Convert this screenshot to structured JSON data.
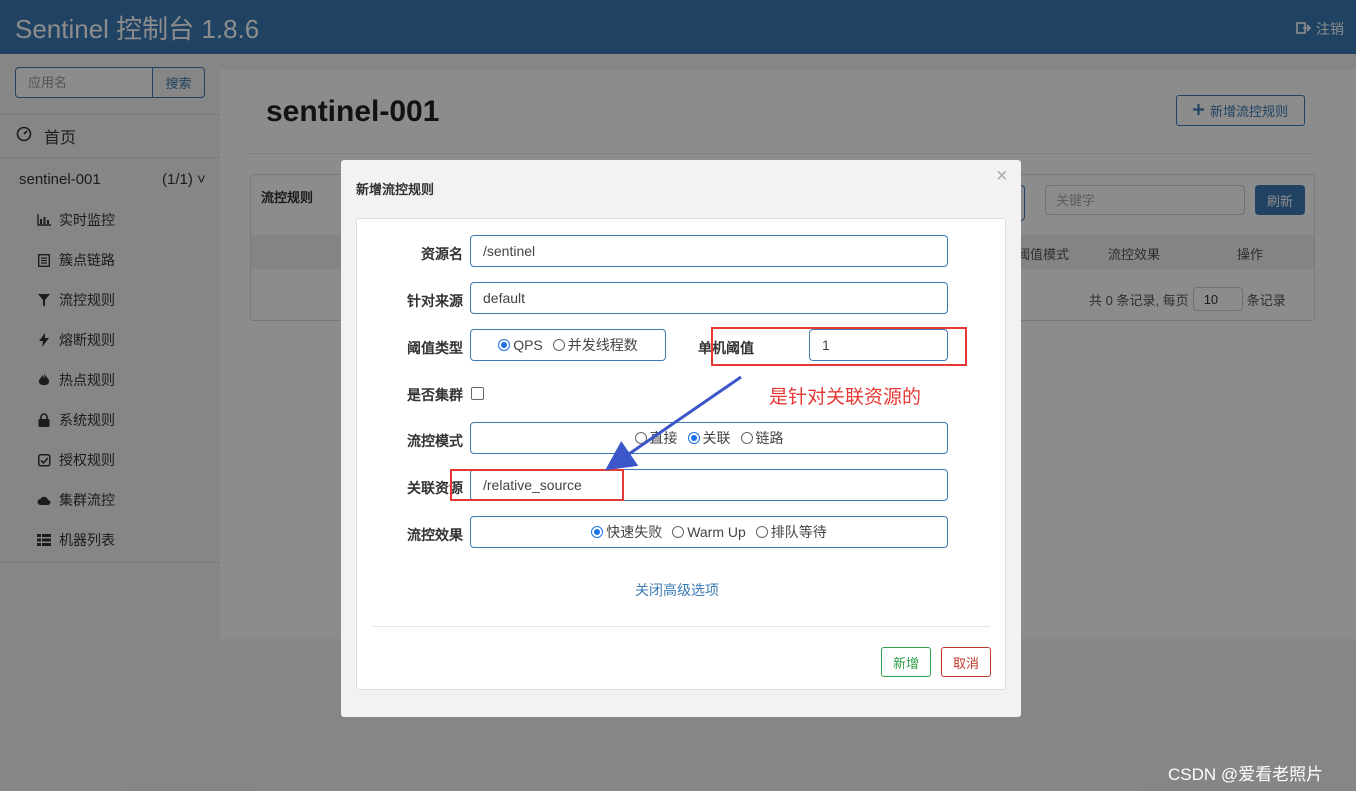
{
  "header": {
    "brand": "Sentinel 控制台 1.8.6",
    "logout": "注销"
  },
  "sidebar": {
    "search_placeholder": "应用名",
    "search_button": "搜索",
    "home": "首页",
    "app_name": "sentinel-001",
    "app_count": "(1/1)",
    "items": [
      {
        "label": "实时监控",
        "icon": "bar-chart-icon"
      },
      {
        "label": "簇点链路",
        "icon": "list-icon"
      },
      {
        "label": "流控规则",
        "icon": "filter-icon"
      },
      {
        "label": "熔断规则",
        "icon": "bolt-icon"
      },
      {
        "label": "热点规则",
        "icon": "fire-icon"
      },
      {
        "label": "系统规则",
        "icon": "lock-icon"
      },
      {
        "label": "授权规则",
        "icon": "check-square-icon"
      },
      {
        "label": "集群流控",
        "icon": "cloud-icon"
      },
      {
        "label": "机器列表",
        "icon": "th-list-icon"
      }
    ]
  },
  "main": {
    "title": "sentinel-001",
    "add_rule_button": "新增流控规则",
    "panel_title": "流控规则",
    "keyword_placeholder": "关键字",
    "refresh_button": "刷新",
    "columns": [
      "阈值模式",
      "流控效果",
      "操作"
    ],
    "pager": {
      "prefix": "共 0 条记录, 每页",
      "page_size": "10",
      "suffix": "条记录"
    }
  },
  "modal": {
    "title": "新增流控规则",
    "close": "×",
    "resource_label": "资源名",
    "resource_value": "/sentinel",
    "origin_label": "针对来源",
    "origin_value": "default",
    "grade_label": "阈值类型",
    "grade_options": [
      "QPS",
      "并发线程数"
    ],
    "grade_selected": "QPS",
    "threshold_label": "单机阈值",
    "threshold_value": "1",
    "cluster_label": "是否集群",
    "cluster_checked": false,
    "strategy_label": "流控模式",
    "strategy_options": [
      "直接",
      "关联",
      "链路"
    ],
    "strategy_selected": "关联",
    "ref_resource_label": "关联资源",
    "ref_resource_value": "/relative_source",
    "behavior_label": "流控效果",
    "behavior_options": [
      "快速失败",
      "Warm Up",
      "排队等待"
    ],
    "behavior_selected": "快速失败",
    "advanced_link": "关闭高级选项",
    "add_button": "新增",
    "cancel_button": "取消"
  },
  "annotation": {
    "text": "是针对关联资源的",
    "color": "#e53935"
  },
  "watermark": "CSDN @爱看老照片",
  "colors": {
    "brand": "#3c7ab4",
    "success": "#2e9e48",
    "danger": "#c0392b",
    "arrow": "#3a56c8"
  }
}
